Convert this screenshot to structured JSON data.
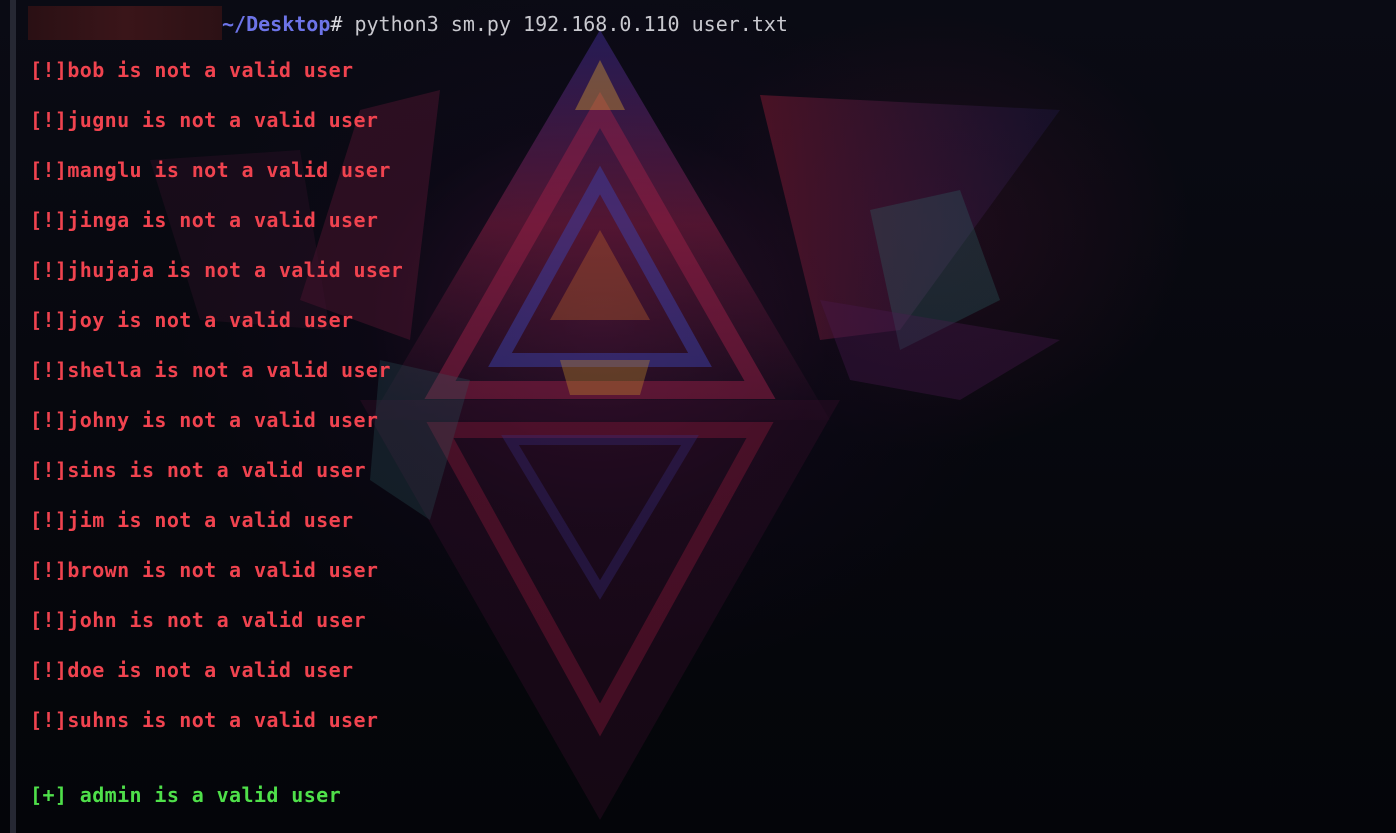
{
  "prompt": {
    "path": "~/Desktop",
    "symbol": "#",
    "command": " python3 sm.py 192.168.0.110 user.txt"
  },
  "output": {
    "errors": [
      "[!]bob is not a valid user",
      "[!]jugnu is not a valid user",
      "[!]manglu is not a valid user",
      "[!]jinga is not a valid user",
      "[!]jhujaja is not a valid user",
      "[!]joy is not a valid user",
      "[!]shella is not a valid user",
      "[!]johny is not a valid user",
      "[!]sins is not a valid user",
      "[!]jim is not a valid user",
      "[!]brown is not a valid user",
      "[!]john is not a valid user",
      "[!]doe is not a valid user",
      "[!]suhns is not a valid user"
    ],
    "success": "[+] admin is a valid user"
  },
  "colors": {
    "error": "#f0434f",
    "success": "#4fe04a",
    "path": "#6d74e8"
  }
}
